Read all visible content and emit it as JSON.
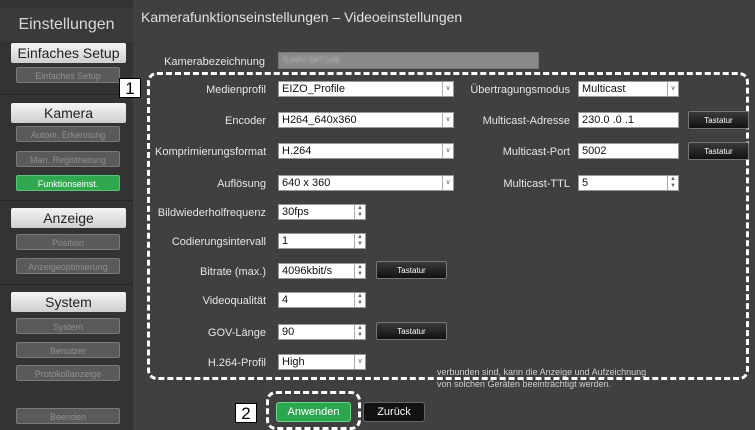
{
  "sidebar": {
    "title": "Einstellungen",
    "sections": [
      {
        "heading": "Einfaches Setup",
        "items": [
          {
            "label": "Einfaches Setup"
          }
        ]
      },
      {
        "heading": "Kamera",
        "items": [
          {
            "label": "Autom. Erkennung"
          },
          {
            "label": "Man. Registrierung"
          },
          {
            "label": "Funktionseinst."
          }
        ]
      },
      {
        "heading": "Anzeige",
        "items": [
          {
            "label": "Position"
          },
          {
            "label": "Anzeigeoptimierung"
          }
        ]
      },
      {
        "heading": "System",
        "items": [
          {
            "label": "System"
          },
          {
            "label": "Benutzer"
          },
          {
            "label": "Protokollanzeige"
          }
        ]
      }
    ],
    "exit_label": "Beenden",
    "active_item": "Funktionseinst."
  },
  "page": {
    "title": "Kamerafunktionseinstellungen – Videoeinstellungen",
    "camera_name_label": "Kamerabezeichnung",
    "camera_name_value": "*L##V-5#T1#8"
  },
  "form": {
    "medienprofil": {
      "label": "Medienprofil",
      "value": "EIZO_Profile"
    },
    "encoder": {
      "label": "Encoder",
      "value": "H264_640x360"
    },
    "komprimierung": {
      "label": "Komprimierungsformat",
      "value": "H.264"
    },
    "aufloesung": {
      "label": "Auflösung",
      "value": "640 x 360"
    },
    "framerate": {
      "label": "Bildwiederholfrequenz",
      "value": "30fps"
    },
    "interval": {
      "label": "Codierungsintervall",
      "value": "1"
    },
    "bitrate": {
      "label": "Bitrate (max.)",
      "value": "4096kbit/s"
    },
    "quality": {
      "label": "Videoqualität",
      "value": "4"
    },
    "gov": {
      "label": "GOV-Länge",
      "value": "90"
    },
    "h264profile": {
      "label": "H.264-Profil",
      "value": "High"
    },
    "uebertragung": {
      "label": "Übertragungsmodus",
      "value": "Multicast"
    },
    "mc_address": {
      "label": "Multicast-Adresse",
      "value": "230.0  .0  .1"
    },
    "mc_port": {
      "label": "Multicast-Port",
      "value": "5002"
    },
    "mc_ttl": {
      "label": "Multicast-TTL",
      "value": "5"
    },
    "keyboard_label": "Tastatur"
  },
  "note": {
    "line1": "verbunden sind, kann die Anzeige und Aufzeichnung",
    "line2": "von solchen Geräten beeinträchtigt werden."
  },
  "markers": {
    "m1": "1",
    "m2": "2"
  },
  "buttons": {
    "apply": "Anwenden",
    "back": "Zurück"
  },
  "colors": {
    "accent_green": "#2fa84f",
    "background": "#404040",
    "sidebar": "#333333"
  }
}
